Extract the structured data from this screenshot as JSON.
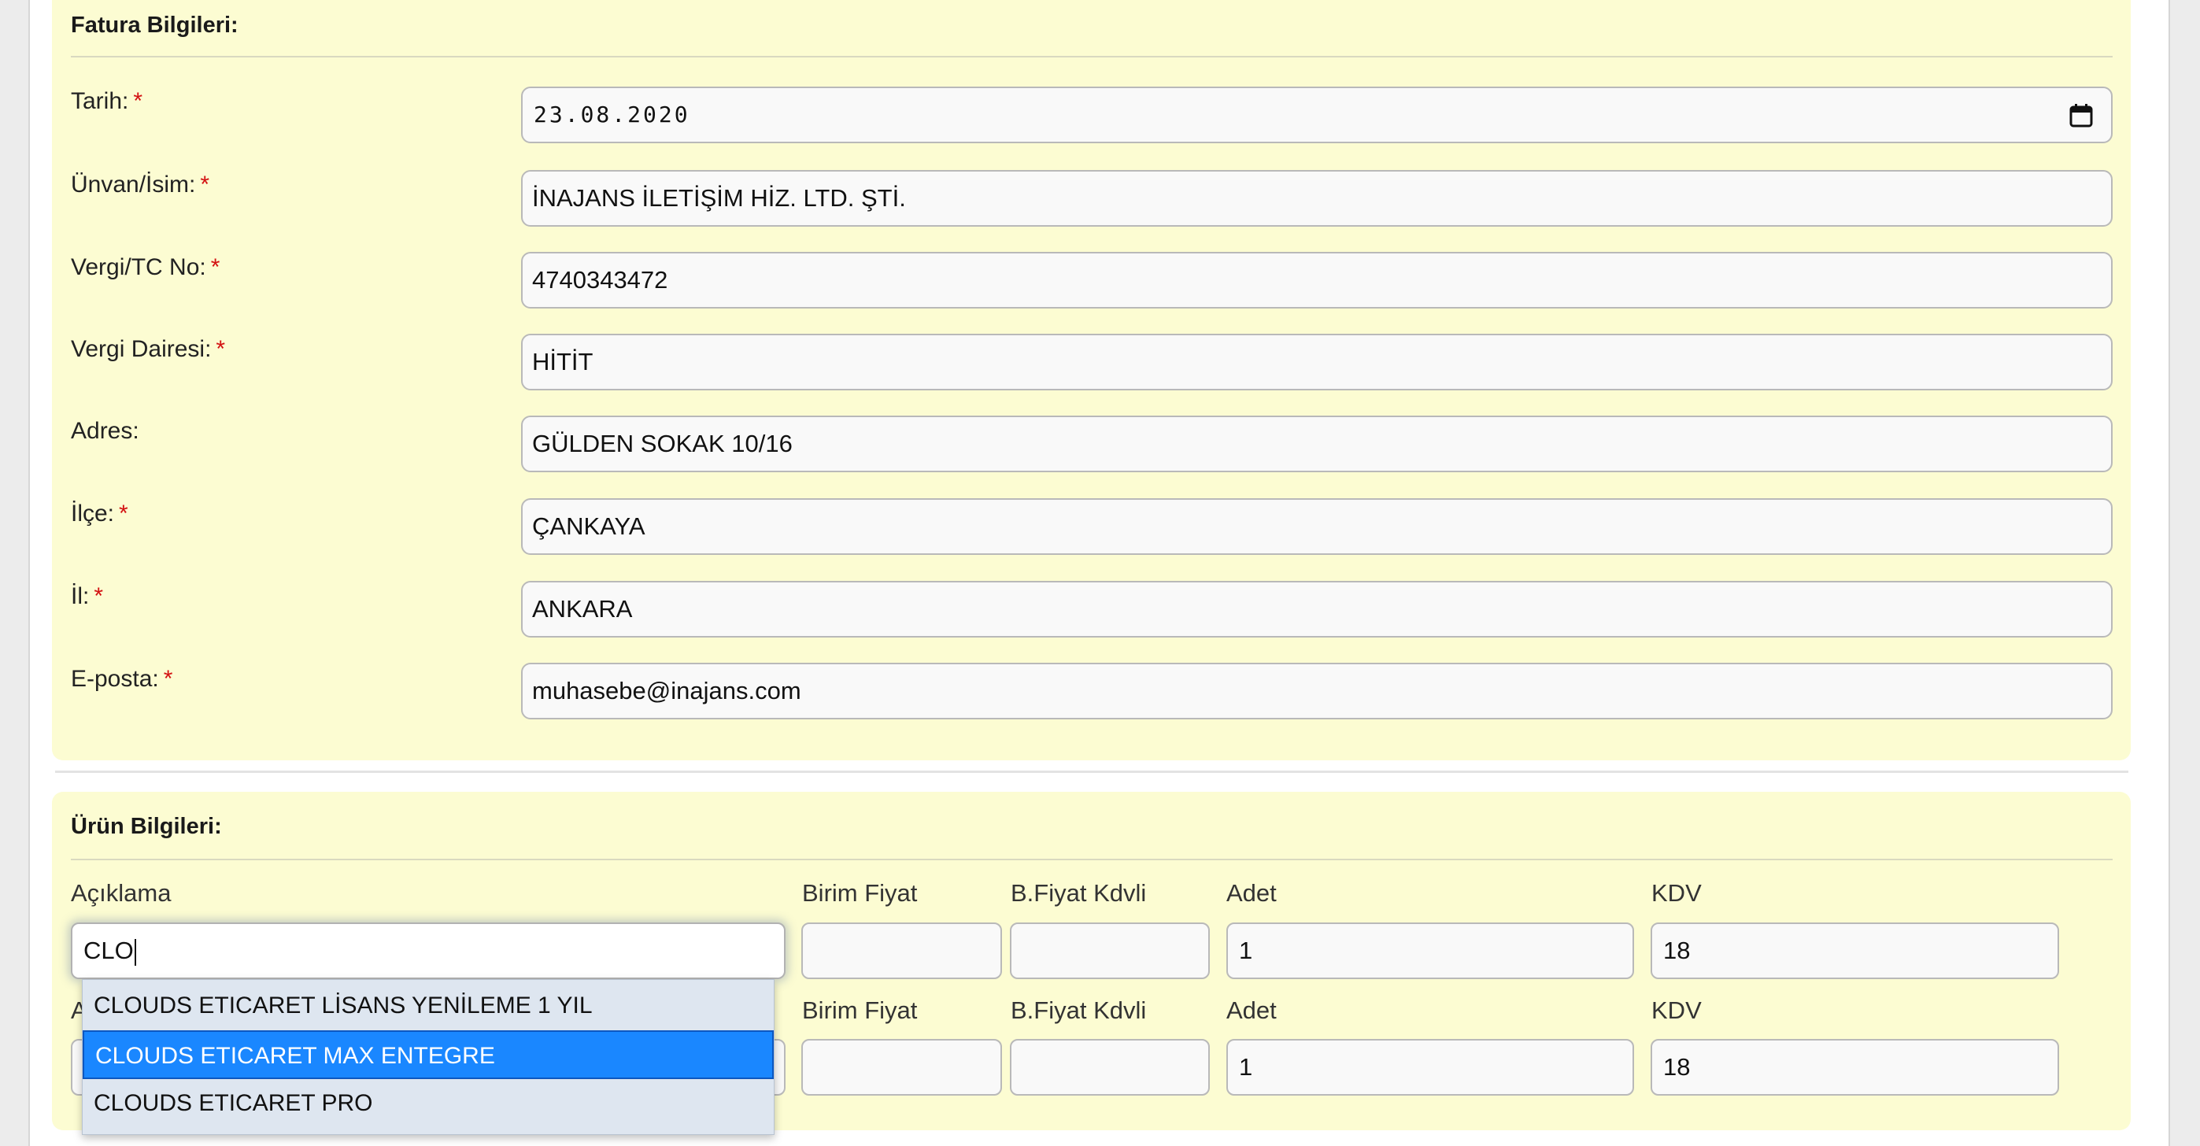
{
  "fatura": {
    "title": "Fatura Bilgileri:",
    "fields": [
      {
        "label": "Tarih:",
        "required": "*",
        "value": "23.08.2020"
      },
      {
        "label": "Ünvan/İsim:",
        "required": "*",
        "value": "İNAJANS İLETİŞİM HİZ. LTD. ŞTİ."
      },
      {
        "label": "Vergi/TC No:",
        "required": "*",
        "value": "4740343472"
      },
      {
        "label": "Vergi Dairesi:",
        "required": "*",
        "value": "HİTİT"
      },
      {
        "label": "Adres:",
        "required": "",
        "value": "GÜLDEN SOKAK 10/16"
      },
      {
        "label": "İlçe:",
        "required": "*",
        "value": "ÇANKAYA"
      },
      {
        "label": "İl:",
        "required": "*",
        "value": "ANKARA"
      },
      {
        "label": "E-posta:",
        "required": "*",
        "value": "muhasebe@inajans.com"
      }
    ]
  },
  "urun": {
    "title": "Ürün Bilgileri:",
    "columns": {
      "aciklama": "Açıklama",
      "birim_fiyat": "Birim Fiyat",
      "b_fiyat_kdvli": "B.Fiyat Kdvli",
      "adet": "Adet",
      "kdv": "KDV"
    },
    "rows": [
      {
        "aciklama": "CLO",
        "birim_fiyat": "",
        "b_fiyat_kdvli": "",
        "adet": "1",
        "kdv": "18"
      },
      {
        "aciklama": "",
        "birim_fiyat": "",
        "b_fiyat_kdvli": "",
        "adet": "1",
        "kdv": "18"
      }
    ],
    "row2_label_glyph": "A"
  },
  "autocomplete": {
    "items": [
      "CLOUDS ETICARET LİSANS YENİLEME 1 YIL",
      "CLOUDS ETICARET MAX ENTEGRE",
      "CLOUDS ETICARET PRO"
    ],
    "active_index": 1
  },
  "icons": {
    "calendar": "calendar-icon"
  },
  "colors": {
    "panel_bg": "#fcfcd2",
    "required": "#d31111",
    "highlight": "#1a87ff"
  }
}
